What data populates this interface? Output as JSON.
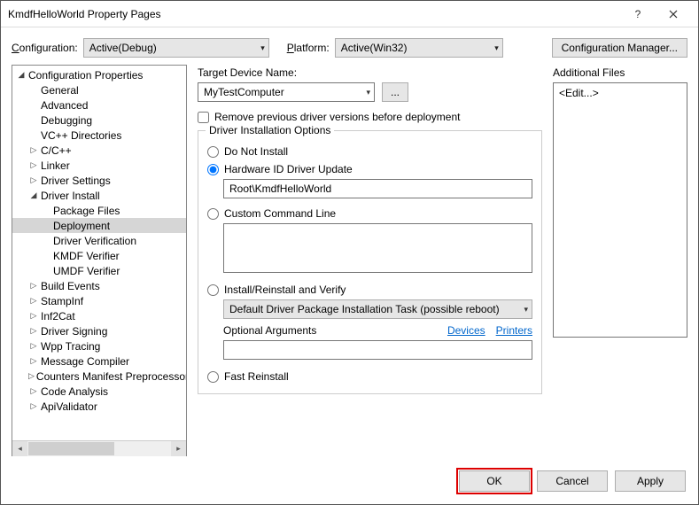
{
  "window": {
    "title": "KmdfHelloWorld Property Pages"
  },
  "toprow": {
    "config_label": "Configuration:",
    "config_value": "Active(Debug)",
    "platform_label": "Platform:",
    "platform_value": "Active(Win32)",
    "cfgmgr": "Configuration Manager..."
  },
  "tree": [
    {
      "d": 0,
      "tw": "◢",
      "label": "Configuration Properties"
    },
    {
      "d": 1,
      "tw": "",
      "label": "General"
    },
    {
      "d": 1,
      "tw": "",
      "label": "Advanced"
    },
    {
      "d": 1,
      "tw": "",
      "label": "Debugging"
    },
    {
      "d": 1,
      "tw": "",
      "label": "VC++ Directories"
    },
    {
      "d": 1,
      "tw": "▷",
      "label": "C/C++"
    },
    {
      "d": 1,
      "tw": "▷",
      "label": "Linker"
    },
    {
      "d": 1,
      "tw": "▷",
      "label": "Driver Settings"
    },
    {
      "d": 1,
      "tw": "◢",
      "label": "Driver Install"
    },
    {
      "d": 2,
      "tw": "",
      "label": "Package Files"
    },
    {
      "d": 2,
      "tw": "",
      "label": "Deployment",
      "selected": true
    },
    {
      "d": 2,
      "tw": "",
      "label": "Driver Verification"
    },
    {
      "d": 2,
      "tw": "",
      "label": "KMDF Verifier"
    },
    {
      "d": 2,
      "tw": "",
      "label": "UMDF Verifier"
    },
    {
      "d": 1,
      "tw": "▷",
      "label": "Build Events"
    },
    {
      "d": 1,
      "tw": "▷",
      "label": "StampInf"
    },
    {
      "d": 1,
      "tw": "▷",
      "label": "Inf2Cat"
    },
    {
      "d": 1,
      "tw": "▷",
      "label": "Driver Signing"
    },
    {
      "d": 1,
      "tw": "▷",
      "label": "Wpp Tracing"
    },
    {
      "d": 1,
      "tw": "▷",
      "label": "Message Compiler"
    },
    {
      "d": 1,
      "tw": "▷",
      "label": "Counters Manifest Preprocessor"
    },
    {
      "d": 1,
      "tw": "▷",
      "label": "Code Analysis"
    },
    {
      "d": 1,
      "tw": "▷",
      "label": "ApiValidator"
    }
  ],
  "main": {
    "target_label": "Target Device Name:",
    "target_value": "MyTestComputer",
    "browse": "...",
    "remove_label": "Remove previous driver versions before deployment",
    "group_legend": "Driver Installation Options",
    "opt_do_not_install": "Do Not Install",
    "opt_hwid": "Hardware ID Driver Update",
    "hwid_value": "Root\\KmdfHelloWorld",
    "opt_custom": "Custom Command Line",
    "opt_install_verify": "Install/Reinstall and Verify",
    "install_task": "Default Driver Package Installation Task (possible reboot)",
    "optional_args": "Optional Arguments",
    "link_devices": "Devices",
    "link_printers": "Printers",
    "opt_fast": "Fast Reinstall",
    "addl_files_label": "Additional Files",
    "addl_files_value": "<Edit...>"
  },
  "footer": {
    "ok": "OK",
    "cancel": "Cancel",
    "apply": "Apply"
  }
}
